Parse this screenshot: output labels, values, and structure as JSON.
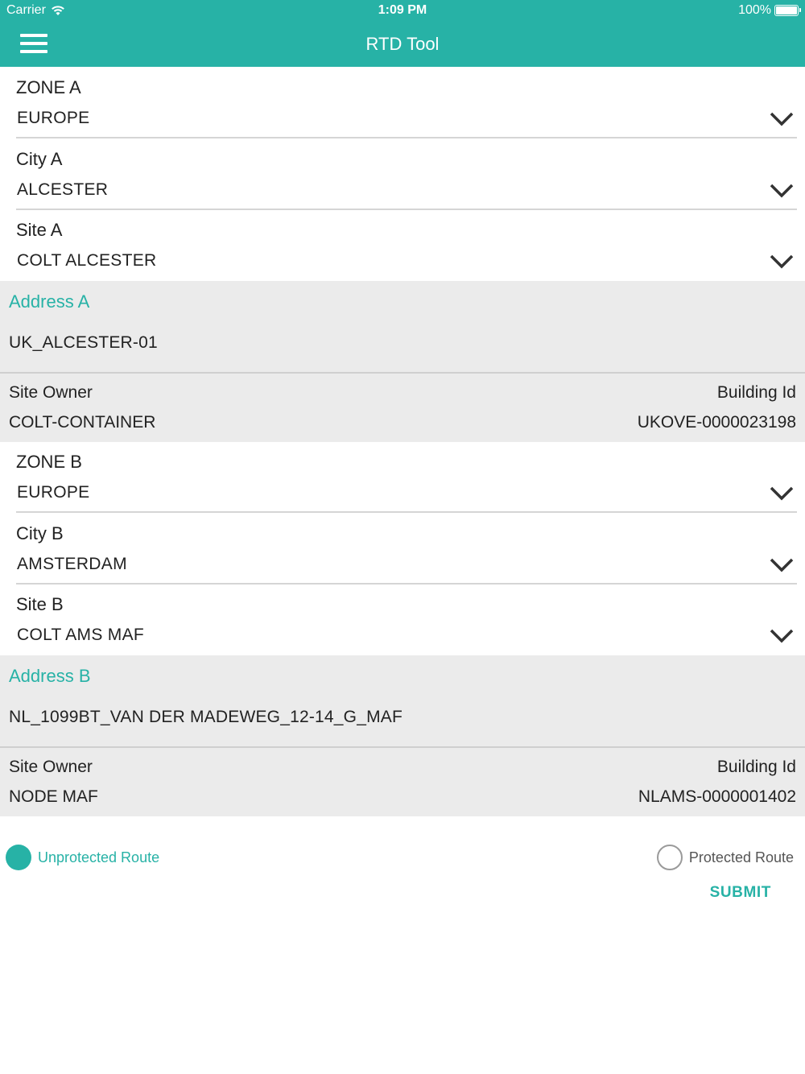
{
  "status_bar": {
    "carrier": "Carrier",
    "time": "1:09 PM",
    "battery": "100%"
  },
  "header": {
    "title": "RTD Tool"
  },
  "side_a": {
    "zone": {
      "label": "ZONE A",
      "value": "EUROPE"
    },
    "city": {
      "label": "City A",
      "value": "ALCESTER"
    },
    "site": {
      "label": "Site A",
      "value": "COLT ALCESTER"
    },
    "address": {
      "label": "Address A",
      "value": "UK_ALCESTER-01"
    },
    "site_owner": {
      "label": "Site Owner",
      "value": "COLT-CONTAINER"
    },
    "building_id": {
      "label": "Building Id",
      "value": "UKOVE-0000023198"
    }
  },
  "side_b": {
    "zone": {
      "label": "ZONE B",
      "value": "EUROPE"
    },
    "city": {
      "label": "City B",
      "value": "AMSTERDAM"
    },
    "site": {
      "label": "Site B",
      "value": "COLT AMS MAF"
    },
    "address": {
      "label": "Address B",
      "value": "NL_1099BT_VAN DER MADEWEG_12-14_G_MAF"
    },
    "site_owner": {
      "label": "Site Owner",
      "value": "NODE MAF"
    },
    "building_id": {
      "label": "Building Id",
      "value": "NLAMS-0000001402"
    }
  },
  "route": {
    "unprotected_label": "Unprotected Route",
    "protected_label": "Protected Route",
    "selected": "unprotected"
  },
  "submit_label": "SUBMIT",
  "colors": {
    "accent": "#27b2a6",
    "panel": "#ebebeb"
  }
}
